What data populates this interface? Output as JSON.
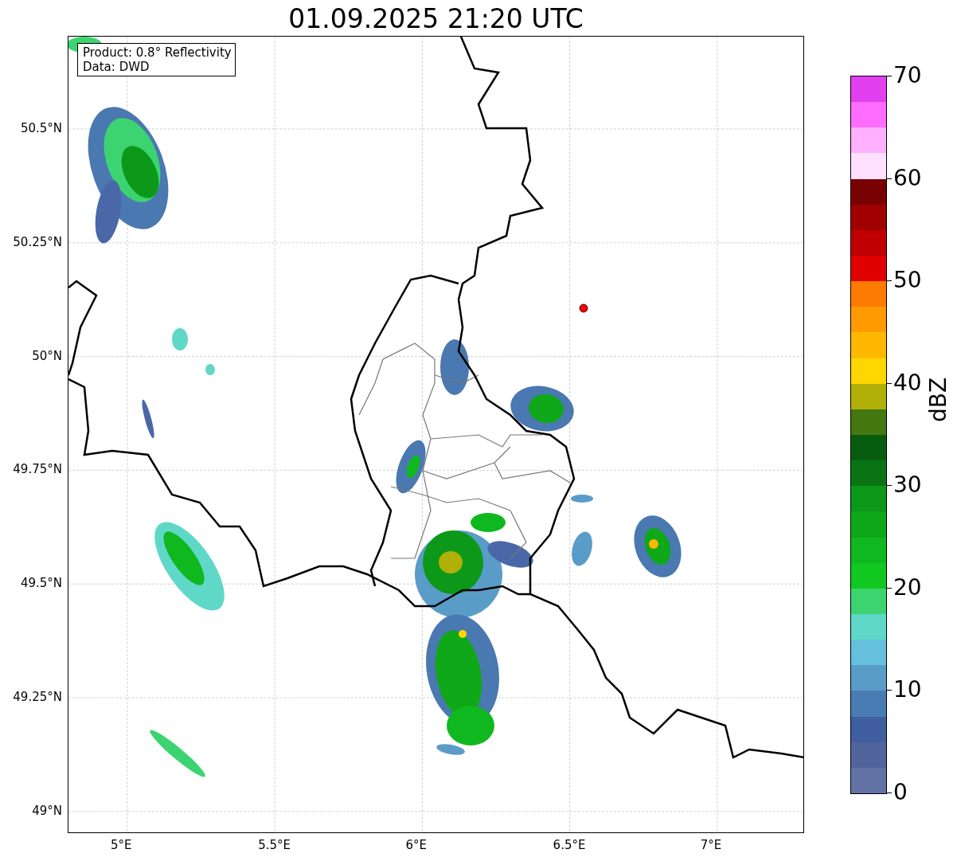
{
  "title": "01.09.2025 21:20 UTC",
  "info_box": {
    "lines": [
      "Product: 0.8° Reflectivity",
      "Data: DWD"
    ]
  },
  "map": {
    "x_ticks": [
      "5°E",
      "5.5°E",
      "6°E",
      "6.5°E",
      "7°E"
    ],
    "y_ticks": [
      "50.5°N",
      "50.25°N",
      "50°N",
      "49.75°N",
      "49.5°N",
      "49.25°N",
      "49°N"
    ]
  },
  "colorbar": {
    "label": "dBZ",
    "ticks": [
      "70",
      "60",
      "50",
      "40",
      "30",
      "20",
      "10",
      "0"
    ],
    "bands": [
      {
        "color": "#e040f0"
      },
      {
        "color": "#ff6cff"
      },
      {
        "color": "#ffb0ff"
      },
      {
        "color": "#ffe0ff"
      },
      {
        "color": "#780000"
      },
      {
        "color": "#a00000"
      },
      {
        "color": "#c00000"
      },
      {
        "color": "#e00000"
      },
      {
        "color": "#ff7a00"
      },
      {
        "color": "#ff9a00"
      },
      {
        "color": "#ffb800"
      },
      {
        "color": "#ffd700"
      },
      {
        "color": "#b0b008"
      },
      {
        "color": "#447810"
      },
      {
        "color": "#085c10"
      },
      {
        "color": "#0a7414"
      },
      {
        "color": "#0c9818"
      },
      {
        "color": "#0ea818"
      },
      {
        "color": "#10b820"
      },
      {
        "color": "#10c820"
      },
      {
        "color": "#3cd470"
      },
      {
        "color": "#60d8c8"
      },
      {
        "color": "#64c0dc"
      },
      {
        "color": "#5a9cc8"
      },
      {
        "color": "#4a7cb4"
      },
      {
        "color": "#405ea0"
      },
      {
        "color": "#52649c"
      },
      {
        "color": "#6272a4"
      }
    ]
  }
}
